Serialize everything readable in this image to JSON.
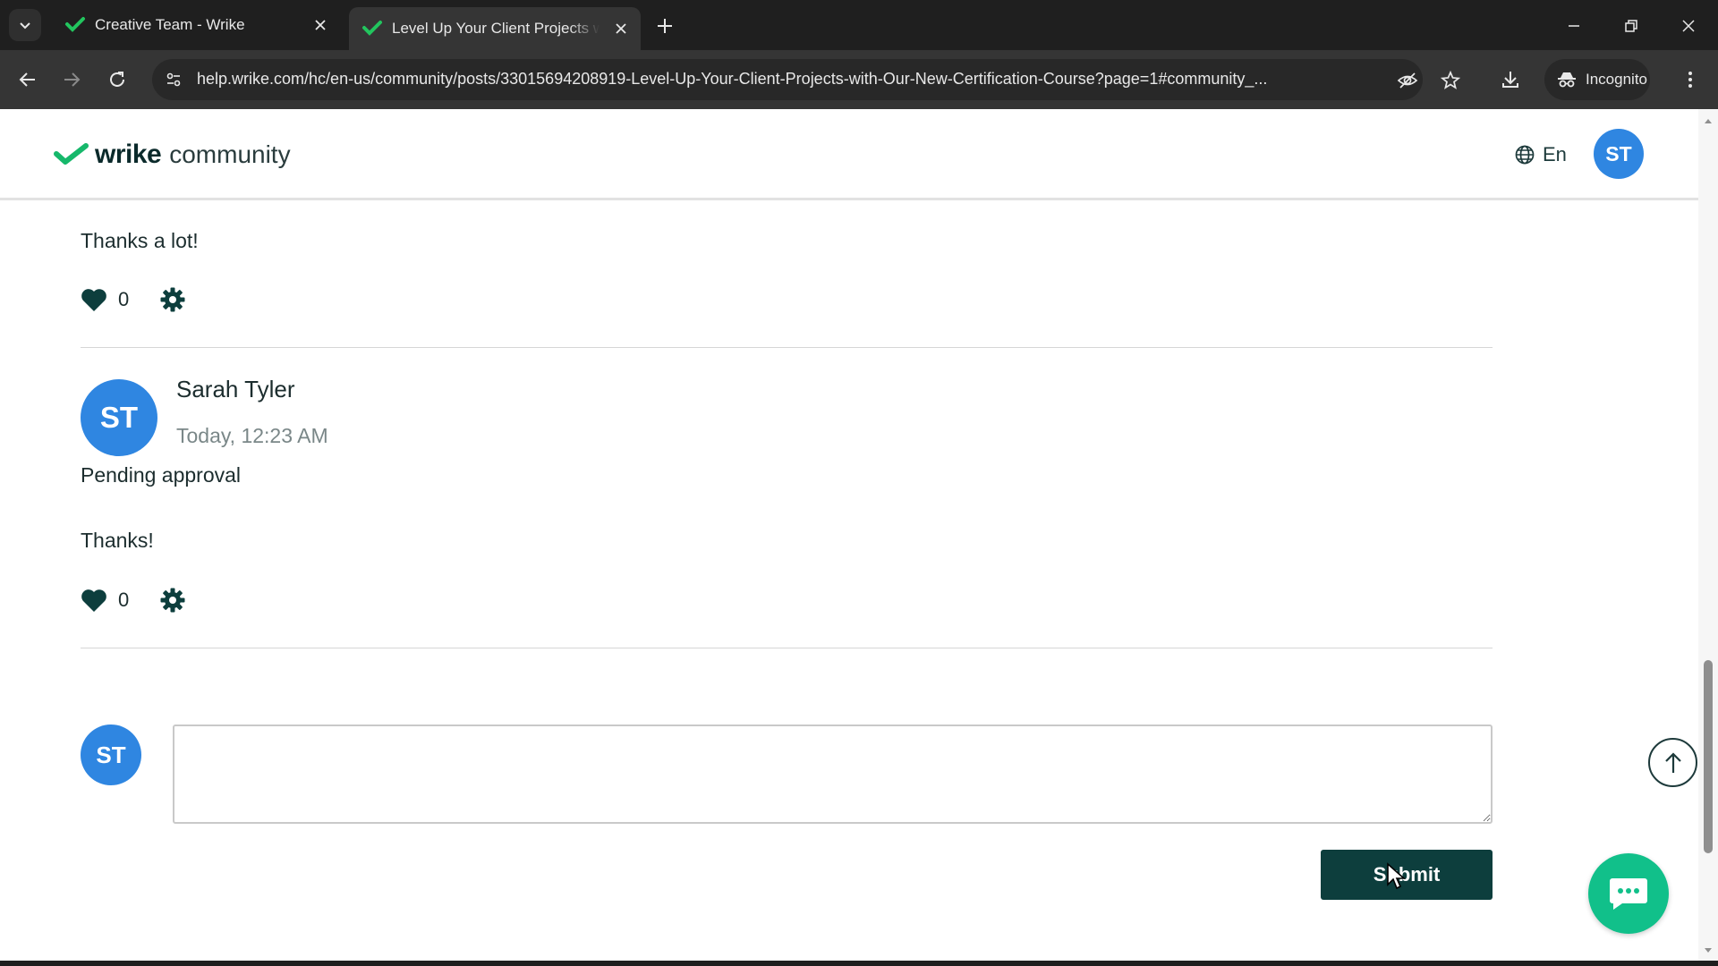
{
  "browser": {
    "tabs": [
      {
        "title": "Creative Team - Wrike",
        "active": false
      },
      {
        "title": "Level Up Your Client Projects w",
        "active": true
      }
    ],
    "url": "help.wrike.com/hc/en-us/community/posts/33015694208919-Level-Up-Your-Client-Projects-with-Our-New-Certification-Course?page=1#community_...",
    "incognito_label": "Incognito"
  },
  "site": {
    "logo_word": "wrike",
    "logo_sub": "community",
    "language": "En",
    "user_initials": "ST",
    "brand_color": "#0d3e3d",
    "avatar_color": "#2f86e1",
    "chat_color": "#11c08a"
  },
  "comments": [
    {
      "body": "Thanks a lot!",
      "likes": "0"
    },
    {
      "author": "Sarah Tyler",
      "initials": "ST",
      "time": "Today, 12:23 AM",
      "status": "Pending approval",
      "body": "Thanks!",
      "likes": "0"
    }
  ],
  "reply": {
    "initials": "ST",
    "value": "",
    "submit_label": "Submit"
  }
}
